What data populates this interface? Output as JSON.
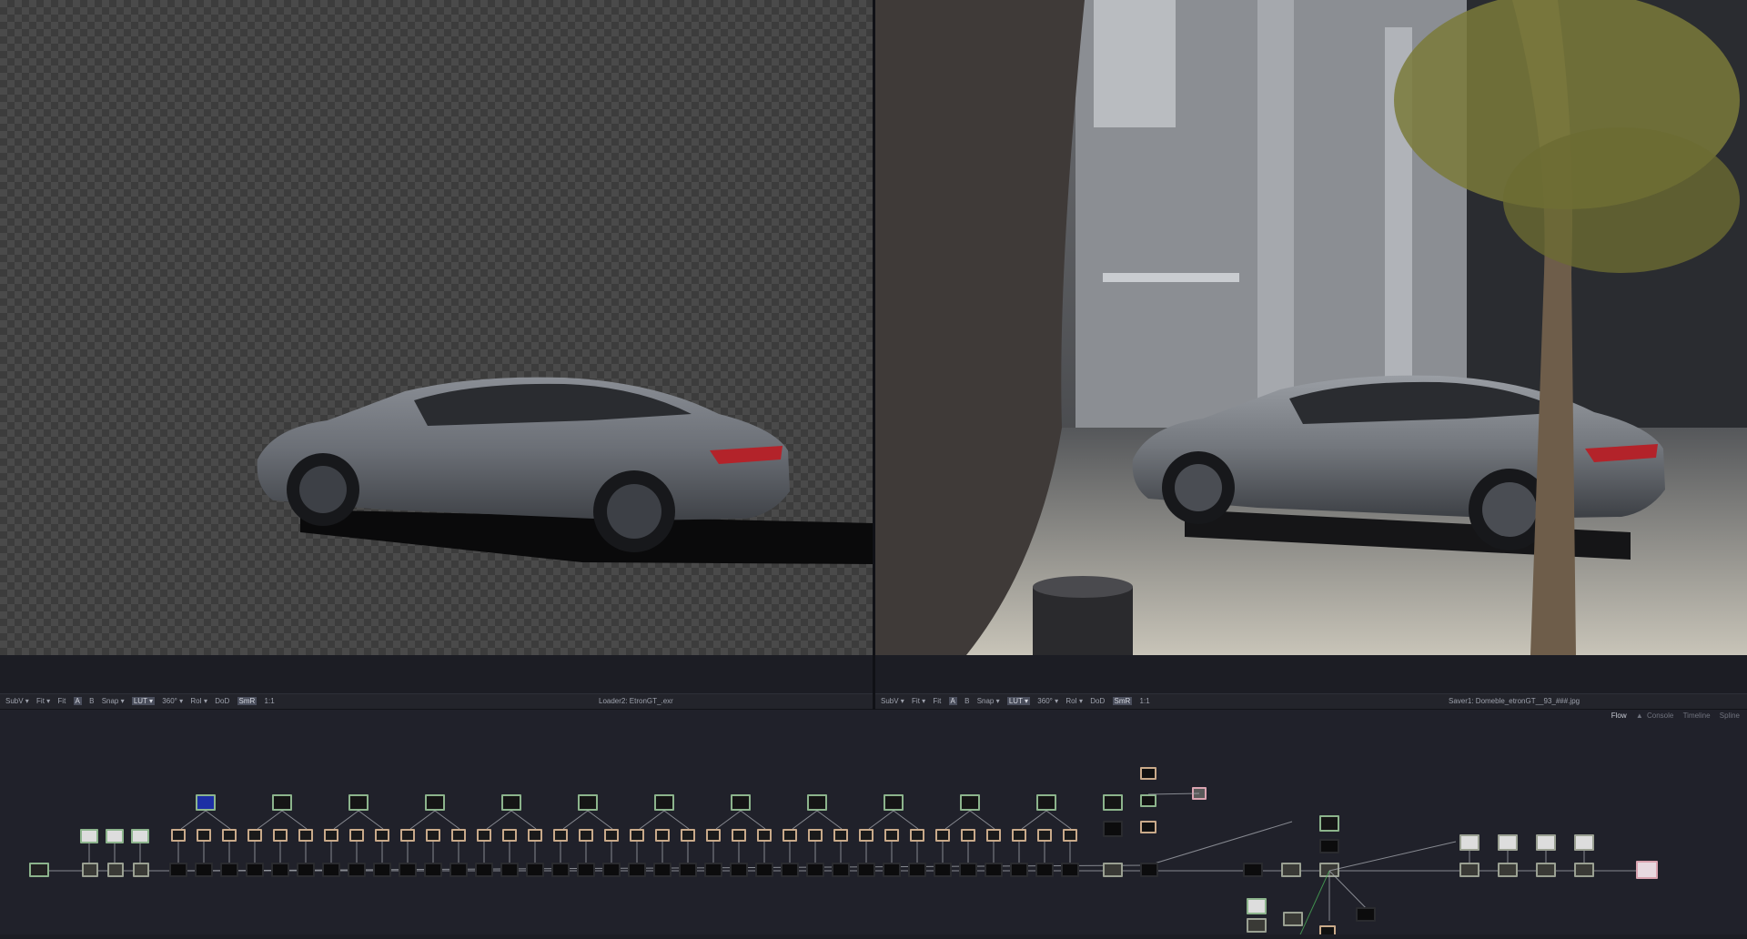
{
  "viewers": {
    "left": {
      "title": "Loader2: EtronGT_.exr",
      "toolbar": [
        "SubV ▾",
        "Fit ▾",
        "Fit",
        "A",
        "B",
        "Snap ▾",
        "LUT ▾",
        "360° ▾",
        "RoI ▾",
        "DoD",
        "SmR",
        "1:1"
      ]
    },
    "right": {
      "title": "Saver1: Domeble_etronGT__93_###.jpg",
      "toolbar": [
        "SubV ▾",
        "Fit ▾",
        "Fit",
        "A",
        "B",
        "Snap ▾",
        "LUT ▾",
        "360° ▾",
        "RoI ▾",
        "DoD",
        "SmR",
        "1:1"
      ]
    }
  },
  "flow_tabs": {
    "flow": "Flow",
    "console": "Console",
    "timeline": "Timeline",
    "spline": "Spline"
  },
  "colors": {
    "app_bg": "#1c1d24",
    "flow_bg": "#20212a",
    "node_loader": "#8cb48c",
    "node_tool": "#c9aa8a",
    "node_merge": "#9aa092",
    "node_saver": "#d9a3b0",
    "connection": "#a9acb3",
    "connection_green": "#4bb35a",
    "checker_light": "#4a4a4a",
    "checker_dark": "#3b3b3b"
  }
}
